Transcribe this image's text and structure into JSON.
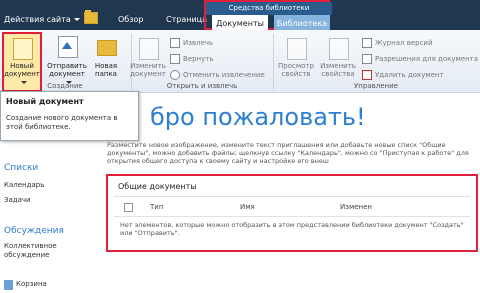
{
  "topbar": {
    "site_actions": "Действия сайта",
    "tab_overview": "Обзор",
    "tab_page": "Страница",
    "tools_title": "Средства библиотеки",
    "tab_documents": "Документы",
    "tab_library": "Библиотека"
  },
  "ribbon": {
    "new_document": [
      "Новый",
      "документ"
    ],
    "upload": [
      "Отправить",
      "документ"
    ],
    "new_folder": [
      "Новая",
      "папка"
    ],
    "edit_document": [
      "Изменить",
      "документ"
    ],
    "checkout": "Извлечь",
    "checkin": "Вернуть",
    "discard_checkout": "Отменить извлечение",
    "view_props": [
      "Просмотр",
      "свойств"
    ],
    "edit_props": [
      "Изменить",
      "свойства"
    ],
    "version_history": "Журнал версий",
    "doc_permissions": "Разрешения для документа",
    "delete_document": "Удалить документ",
    "group_create": "Создание",
    "group_open": "Открыть и извлечь",
    "group_manage": "Управление"
  },
  "tooltip": {
    "title": "Новый документ",
    "body": "Создание нового документа в этой библиотеке."
  },
  "main": {
    "welcome": "бро пожаловать!",
    "intro": "Разместите новое изображение, измените текст приглашения или добавьте новые списк \"Общие документы\", можно добавить файлы; щелкнув ссылку \"Календарь\", можно со \"Приступая к работе\" для открытия общего доступа к своему сайту и настройке его внеш"
  },
  "sidebar": {
    "lists_head": "Списки",
    "calendar": "Календарь",
    "tasks": "Задачи",
    "discussions_head": "Обсуждения",
    "team_discussion": [
      "Коллективное",
      "обсуждение"
    ],
    "recycle_bin": "Корзина"
  },
  "webpart": {
    "title": "Общие документы",
    "col_type": "Тип",
    "col_name": "Имя",
    "col_modified": "Изменен",
    "empty": "Нет элементов, которые можно отобразить в этом представлении библиотеки документ \"Создать\" или \"Отправить\"."
  },
  "colors": {
    "topbar_bg": "#20384f",
    "accent_blue": "#2d7fd0",
    "highlight_red": "#e0203a",
    "tab_library": "#86b3dc"
  }
}
